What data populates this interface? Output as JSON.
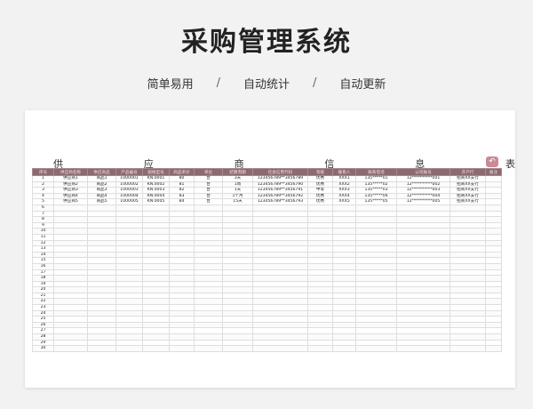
{
  "header": {
    "title": "采购管理系统",
    "features": [
      "简单易用",
      "自动统计",
      "自动更新"
    ],
    "separator": "/"
  },
  "sheet": {
    "title_chars": [
      "供",
      "应",
      "商",
      "信",
      "息",
      "表"
    ],
    "return_icon": "return-arrow-icon",
    "accent_color": "#8c6a72",
    "columns": [
      "序号",
      "供应商名称",
      "供应商品",
      "产品编号",
      "规格型号",
      "商品单价",
      "单位",
      "结算周期",
      "社会信用代码",
      "等级",
      "联系人",
      "联系电话",
      "公司账号",
      "开户行",
      "备注"
    ],
    "rows": [
      [
        "1",
        "供应商1",
        "商品1",
        "1000001",
        "KN.0001",
        "80",
        "台",
        "3天",
        "123456789**3456789",
        "优秀",
        "XXX1",
        "135*****01",
        "12**********001",
        "招商XX支行",
        ""
      ],
      [
        "2",
        "供应商2",
        "商品2",
        "1000002",
        "KN.0002",
        "81",
        "台",
        "1周",
        "123456789**3456790",
        "优秀",
        "XXX2",
        "135*****02",
        "12**********002",
        "招商XX支行",
        ""
      ],
      [
        "3",
        "供应商3",
        "商品3",
        "1000003",
        "KN.0003",
        "82",
        "台",
        "1天",
        "123456789**3456791",
        "中等",
        "XXX3",
        "135*****03",
        "12**********003",
        "招商XX支行",
        ""
      ],
      [
        "4",
        "供应商4",
        "商品4",
        "1000004",
        "KN.0004",
        "83",
        "台",
        "1个月",
        "123456789**3456792",
        "优秀",
        "XXX4",
        "135*****04",
        "12**********004",
        "招商XX支行",
        ""
      ],
      [
        "5",
        "供应商5",
        "商品5",
        "1000005",
        "KN.0005",
        "84",
        "台",
        "15天",
        "123456789**3456793",
        "优秀",
        "XXX5",
        "135*****05",
        "12**********005",
        "招商XX支行",
        ""
      ],
      [
        "6"
      ],
      [
        "7"
      ],
      [
        "8"
      ],
      [
        "9"
      ],
      [
        "10"
      ],
      [
        "11"
      ],
      [
        "12"
      ],
      [
        "13"
      ],
      [
        "14"
      ],
      [
        "15"
      ],
      [
        "16"
      ],
      [
        "17"
      ],
      [
        "18"
      ],
      [
        "19"
      ],
      [
        "20"
      ],
      [
        "21"
      ],
      [
        "22"
      ],
      [
        "23"
      ],
      [
        "24"
      ],
      [
        "25"
      ],
      [
        "26"
      ],
      [
        "27"
      ],
      [
        "28"
      ],
      [
        "29"
      ],
      [
        "30"
      ]
    ]
  }
}
